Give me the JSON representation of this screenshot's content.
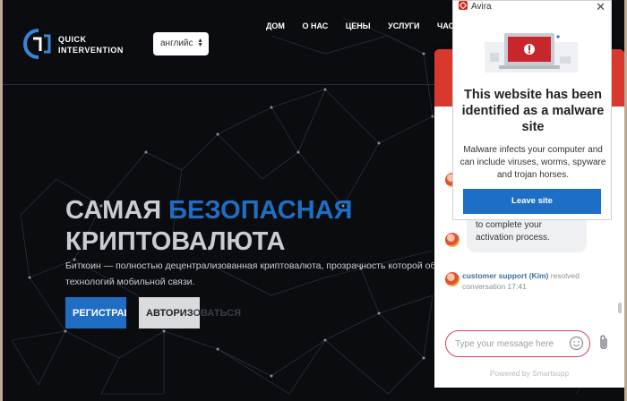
{
  "site": {
    "logo_line1": "QUICK",
    "logo_line2": "INTERVENTION",
    "language_select": "английс",
    "nav": [
      "ДОМ",
      "О НАС",
      "ЦЕНЫ",
      "УСЛУГИ",
      "ЧАСТО З"
    ],
    "hero_title_part1": "САМАЯ ",
    "hero_title_accent": "БЕЗОПАСНАЯ",
    "hero_title_line2": "КРИПТОВАЛЮТА",
    "hero_subtitle_line1": "Биткоин — полностью децентрализованная криптовалюта, прозрачность которой обесп",
    "hero_subtitle_line2": "технологий мобильной связи.",
    "register_button": "РЕГИСТРАЦИЯ",
    "authorize_button_visible": "АВТОРИЗ",
    "authorize_button_faded": "ОВАТЬСЯ"
  },
  "chat": {
    "message_line1": "to complete your",
    "message_line2": "activation process.",
    "resolved_agent": "customer support (Kim)",
    "resolved_text": " resolved",
    "resolved_line2": "conversation 17:41",
    "input_placeholder": "Type your message here",
    "powered_by": "Powered by Smartsupp"
  },
  "avira": {
    "brand": "Avira",
    "headline": "This website has been identified as a malware site",
    "body": "Malware infects your computer and can include viruses, worms, spyware and trojan horses.",
    "leave_button": "Leave site"
  },
  "colors": {
    "accent_blue": "#1f6ec4",
    "avira_red": "#d52b1e",
    "chat_header_red": "#d9382c"
  }
}
